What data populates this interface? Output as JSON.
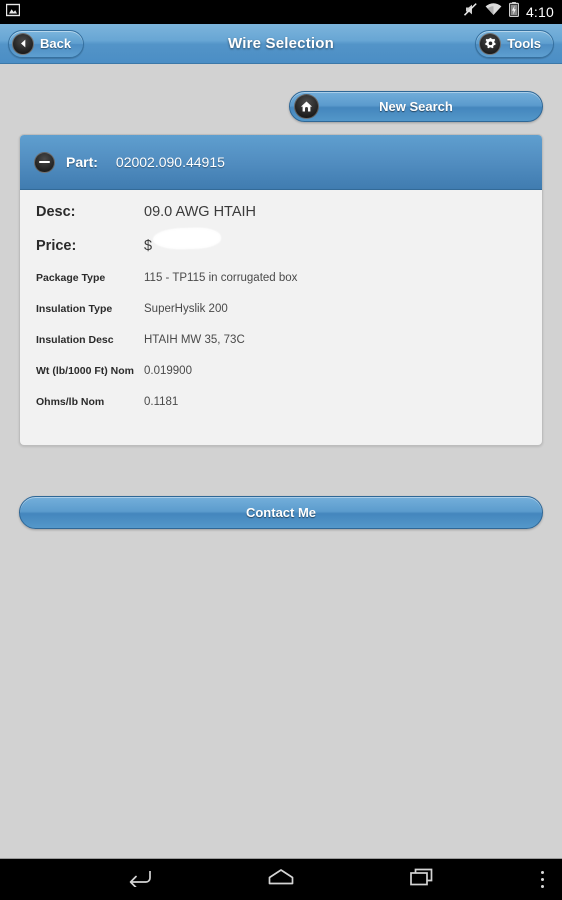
{
  "status_bar": {
    "notification_icon": "image-icon",
    "icons": [
      "mute-icon",
      "wifi-icon",
      "battery-charging-icon"
    ],
    "time": "4:10"
  },
  "titlebar": {
    "back_label": "Back",
    "back_icon": "chevron-left-icon",
    "title": "Wire Selection",
    "tools_label": "Tools",
    "tools_icon": "gear-icon"
  },
  "toolbar": {
    "new_search_label": "New Search",
    "new_search_icon": "home-icon"
  },
  "part_card": {
    "collapse_icon": "minus-circle-icon",
    "header_label": "Part:",
    "header_value": "02002.090.44915",
    "details": [
      {
        "label": "Desc:",
        "value": "09.0 AWG HTAIH",
        "size": "primary"
      },
      {
        "label": "Price:",
        "value": "$",
        "size": "primary",
        "redacted": true
      },
      {
        "label": "Package Type",
        "value": "115 - TP115 in corrugated box",
        "size": "secondary"
      },
      {
        "label": "Insulation Type",
        "value": "SuperHyslik 200",
        "size": "secondary"
      },
      {
        "label": "Insulation Desc",
        "value": "HTAIH MW 35, 73C",
        "size": "secondary"
      },
      {
        "label": "Wt (lb/1000 Ft) Nom",
        "value": "0.019900",
        "size": "secondary"
      },
      {
        "label": "Ohms/lb Nom",
        "value": "0.1181",
        "size": "secondary"
      }
    ]
  },
  "actions": {
    "contact_me_label": "Contact Me"
  },
  "navbar": {
    "back_icon": "nav-back-icon",
    "home_icon": "nav-home-icon",
    "recents_icon": "nav-recents-icon",
    "overflow_icon": "overflow-menu-icon"
  },
  "colors": {
    "accent_blue": "#5394c8",
    "header_blue_dark": "#407cb0",
    "page_background": "#d2d2d2",
    "card_background": "#f2f2f2",
    "system_black": "#000000"
  }
}
